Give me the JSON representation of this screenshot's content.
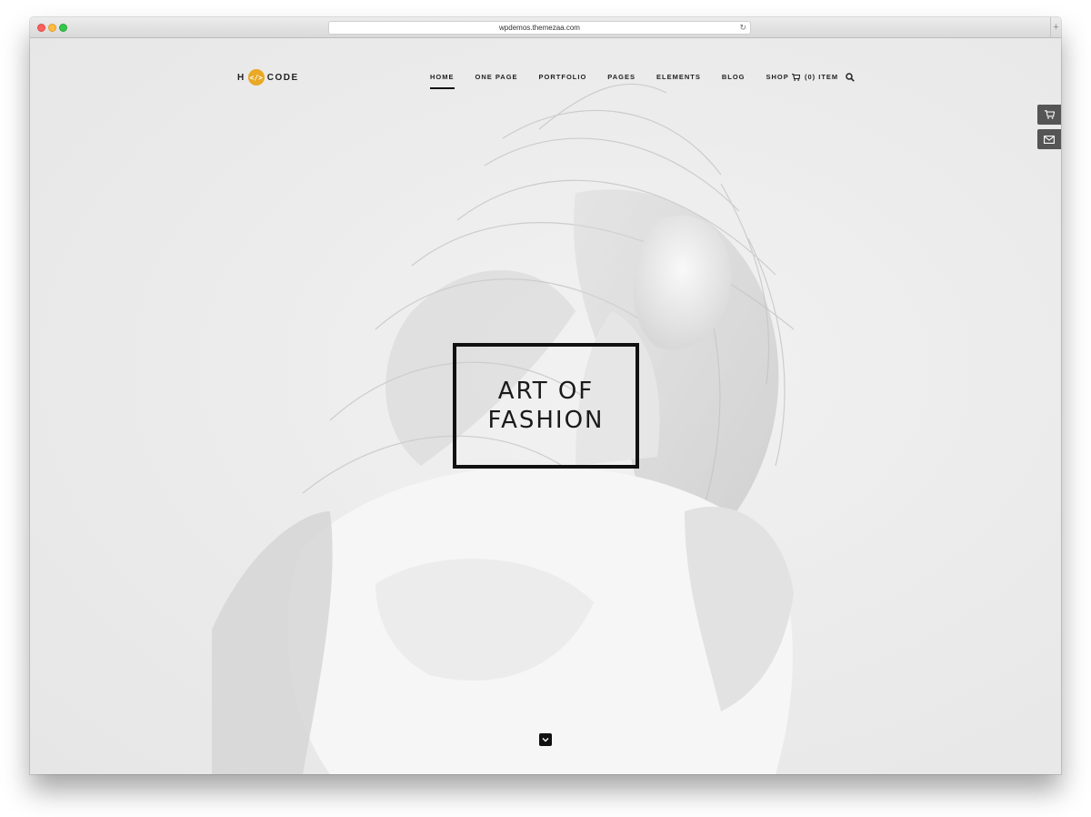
{
  "browser": {
    "url": "wpdemos.themezaa.com"
  },
  "header": {
    "logo_left": "H",
    "logo_mark": "</>",
    "logo_right": "CODE",
    "nav": [
      {
        "label": "HOME",
        "active": true
      },
      {
        "label": "ONE PAGE",
        "active": false
      },
      {
        "label": "PORTFOLIO",
        "active": false
      },
      {
        "label": "PAGES",
        "active": false
      },
      {
        "label": "ELEMENTS",
        "active": false
      },
      {
        "label": "BLOG",
        "active": false
      },
      {
        "label": "SHOP",
        "active": false
      }
    ],
    "cart_label": "(0) ITEM",
    "icons": {
      "cart": "cart-icon",
      "search": "search-icon"
    }
  },
  "side_tools": [
    "cart-icon",
    "mail-icon"
  ],
  "hero": {
    "title_line1": "ART OF",
    "title_line2": "FASHION",
    "scroll_icon": "chevron-down-icon"
  },
  "colors": {
    "accent": "#e9a825",
    "text": "#222222",
    "side_tool_bg": "#555555"
  }
}
